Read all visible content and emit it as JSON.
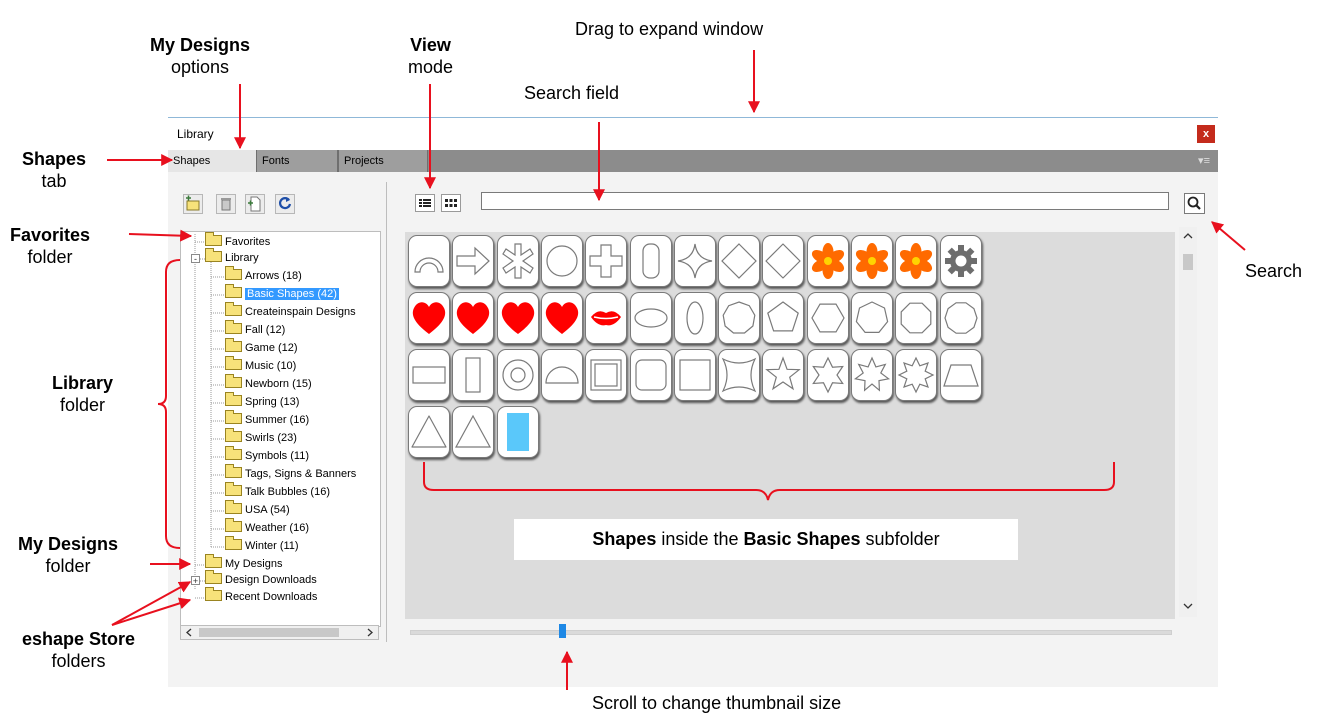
{
  "annotations": {
    "drag_expand": "Drag to expand window",
    "my_designs_options_bold": "My Designs",
    "my_designs_options_rest": "options",
    "view_bold": "View",
    "view_rest": "mode",
    "search_field": "Search field",
    "shapes_tab_bold": "Shapes",
    "shapes_tab_rest": "tab",
    "favorites_bold": "Favorites",
    "favorites_rest": "folder",
    "library_bold": "Library",
    "library_rest": "folder",
    "my_designs_folder_bold": "My Designs",
    "my_designs_folder_rest": "folder",
    "eshape_bold": "eshape Store",
    "eshape_rest": "folders",
    "search": "Search",
    "shapes_inside": [
      "Shapes",
      " inside the ",
      "Basic Shapes",
      " subfolder"
    ],
    "thumbnail_scroll": "Scroll to change thumbnail size",
    "arrow_color": "#e8101e"
  },
  "window": {
    "title": "Library",
    "close_label": "x",
    "tab_menu": "▾≡",
    "tabs": [
      "Shapes",
      "Fonts",
      "Projects"
    ]
  },
  "tree": {
    "favorites": "Favorites",
    "library": "Library",
    "children": [
      "Arrows (18)",
      "Basic Shapes (42)",
      "Createinspain Designs",
      "Fall (12)",
      "Game (12)",
      "Music (10)",
      "Newborn (15)",
      "Spring (13)",
      "Summer (16)",
      "Swirls (23)",
      "Symbols (11)",
      "Tags, Signs & Banners",
      "Talk Bubbles (16)",
      "USA (54)",
      "Weather (16)",
      "Winter (11)"
    ],
    "selected_index": 1,
    "my_designs": "My Designs",
    "design_downloads": "Design Downloads",
    "recent_downloads": "Recent Downloads",
    "expand_symbol": "+",
    "collapse_symbol": "-"
  },
  "shapes": [
    "arc",
    "arrow",
    "asterisk",
    "circle",
    "cross",
    "rounded-tall",
    "star4",
    "diamond",
    "diamond-rounded",
    "flower",
    "flower",
    "flower",
    "gear",
    "heart",
    "heart",
    "heart",
    "heart",
    "lips",
    "ellipse",
    "ellipse-tall",
    "nonagon",
    "pentagon",
    "hexagon",
    "heptagon",
    "octagon",
    "decagon",
    "rectangle",
    "tall-rectangle",
    "ring",
    "semicircle",
    "square-double",
    "rounded-square",
    "square",
    "concave-square",
    "star5",
    "star6",
    "star7",
    "star8",
    "trapezoid",
    "triangle-rounded",
    "triangle",
    "blue-rect"
  ],
  "colors": {
    "red": "#ff0000",
    "orange": "#ff6a00",
    "yellow": "#ffd400",
    "gray": "#6d6d6d",
    "blue": "#5ac8fa"
  },
  "slider": {
    "level": 0.2
  }
}
